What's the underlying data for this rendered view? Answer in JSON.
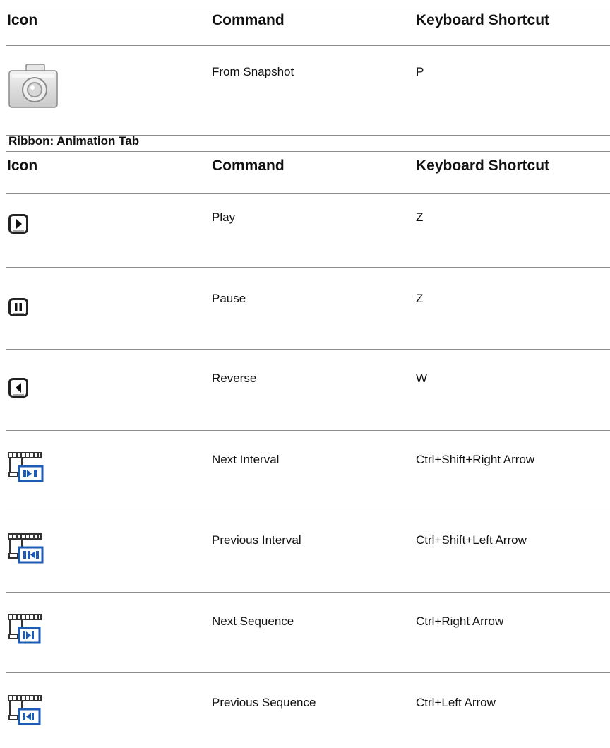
{
  "headers": {
    "icon": "Icon",
    "command": "Command",
    "shortcut": "Keyboard Shortcut"
  },
  "section_title": "Ribbon: Animation Tab",
  "table1": [
    {
      "icon": "camera-icon",
      "command": "From Snapshot",
      "shortcut": "P"
    }
  ],
  "table2": [
    {
      "icon": "play-icon",
      "command": "Play",
      "shortcut": "Z"
    },
    {
      "icon": "pause-icon",
      "command": "Pause",
      "shortcut": "Z"
    },
    {
      "icon": "reverse-icon",
      "command": "Reverse",
      "shortcut": "W"
    },
    {
      "icon": "next-interval-icon",
      "command": "Next Interval",
      "shortcut": "Ctrl+Shift+Right Arrow"
    },
    {
      "icon": "previous-interval-icon",
      "command": "Previous Interval",
      "shortcut": "Ctrl+Shift+Left Arrow"
    },
    {
      "icon": "next-sequence-icon",
      "command": "Next Sequence",
      "shortcut": "Ctrl+Right Arrow"
    },
    {
      "icon": "previous-sequence-icon",
      "command": "Previous Sequence",
      "shortcut": "Ctrl+Left Arrow"
    }
  ]
}
